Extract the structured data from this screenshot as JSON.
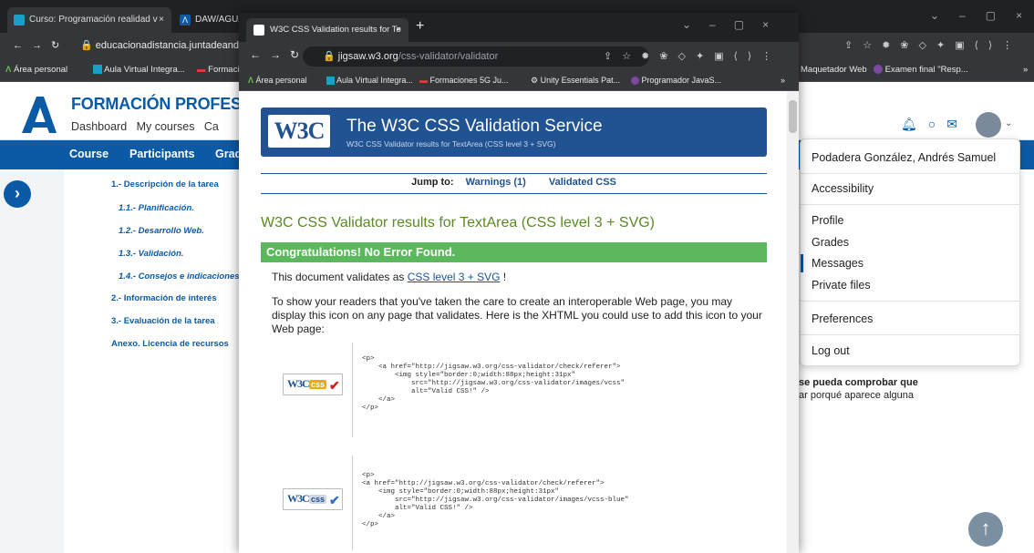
{
  "back": {
    "tabs": [
      {
        "label": "Curso: Programación realidad v",
        "close": "×"
      },
      {
        "label": "DAW/AGUA"
      }
    ],
    "url": "educacionadistancia.juntadeanda",
    "bookmarks": [
      "Área personal",
      "Aula Virtual Integra...",
      "Formaci",
      "Maquetador Web",
      "Examen final \"Resp...",
      "»"
    ],
    "brand": "FORMACIÓN PROFESIONA",
    "topnav": [
      "Dashboard",
      "My courses",
      "Ca"
    ],
    "bluenav": [
      "Course",
      "Participants",
      "Grad"
    ],
    "toc": [
      {
        "label": "1.- Descripción de la tarea",
        "style": "b"
      },
      {
        "label": "1.1.- Planificación.",
        "style": "i"
      },
      {
        "label": "1.2.- Desarrollo Web.",
        "style": "i"
      },
      {
        "label": "1.3.- Validación.",
        "style": "i"
      },
      {
        "label": "1.4.- Consejos e indicaciones",
        "style": "i"
      },
      {
        "label": "2.- Información de interés",
        "style": "b"
      },
      {
        "label": "3.- Evaluación de la tarea",
        "style": "b"
      },
      {
        "label": "Anexo. Licencia de recursos",
        "style": "b"
      }
    ],
    "fragment1": "se pueda comprobar que",
    "fragment2": "ar porqué aparece alguna",
    "menu": {
      "user": "Podadera González, Andrés Samuel",
      "items": [
        "Accessibility",
        "Profile",
        "Grades",
        "Messages",
        "Private files",
        "Preferences",
        "Log out"
      ]
    }
  },
  "front": {
    "tab": "W3C CSS Validation results for Te",
    "url_host": "jigsaw.w3.org",
    "url_path": "/css-validator/validator",
    "bookmarks": [
      "Área personal",
      "Aula Virtual Integra...",
      "Formaciones 5G Ju...",
      "Unity Essentials Pat...",
      "Programador JavaS...",
      "»"
    ],
    "logo": "W3C",
    "title": "The W3C CSS Validation Service",
    "subtitle": "W3C CSS Validator results for TextArea (CSS level 3 + SVG)",
    "jump_label": "Jump to:",
    "jump_links": [
      "Warnings (1)",
      "Validated CSS"
    ],
    "results_title": "W3C CSS Validator results for TextArea (CSS level 3 + SVG)",
    "congrats": "Congratulations! No Error Found.",
    "validates_prefix": "This document validates as ",
    "validates_link": "CSS level 3 + SVG",
    "validates_suffix": " !",
    "para": "To show your readers that you've taken the care to create an interoperable Web page, you may display this icon on any page that validates. Here is the XHTML you could use to add this icon to your Web page:",
    "code1": "<p>\n    <a href=\"http://jigsaw.w3.org/css-validator/check/referer\">\n        <img style=\"border:0;width:88px;height:31px\"\n            src=\"http://jigsaw.w3.org/css-validator/images/vcss\"\n            alt=\"Valid CSS!\" />\n    </a>\n</p>",
    "code2": "<p>\n<a href=\"http://jigsaw.w3.org/css-validator/check/referer\">\n    <img style=\"border:0;width:88px;height:31px\"\n        src=\"http://jigsaw.w3.org/css-validator/images/vcss-blue\"\n        alt=\"Valid CSS!\" />\n    </a>\n</p>",
    "badge_w3c": "W3C",
    "badge_css": "css"
  },
  "colors": {
    "moodle_blue": "#0a5aa6",
    "w3c_blue": "#215291",
    "success": "#5cb85c",
    "chrome_dark": "#202124"
  }
}
